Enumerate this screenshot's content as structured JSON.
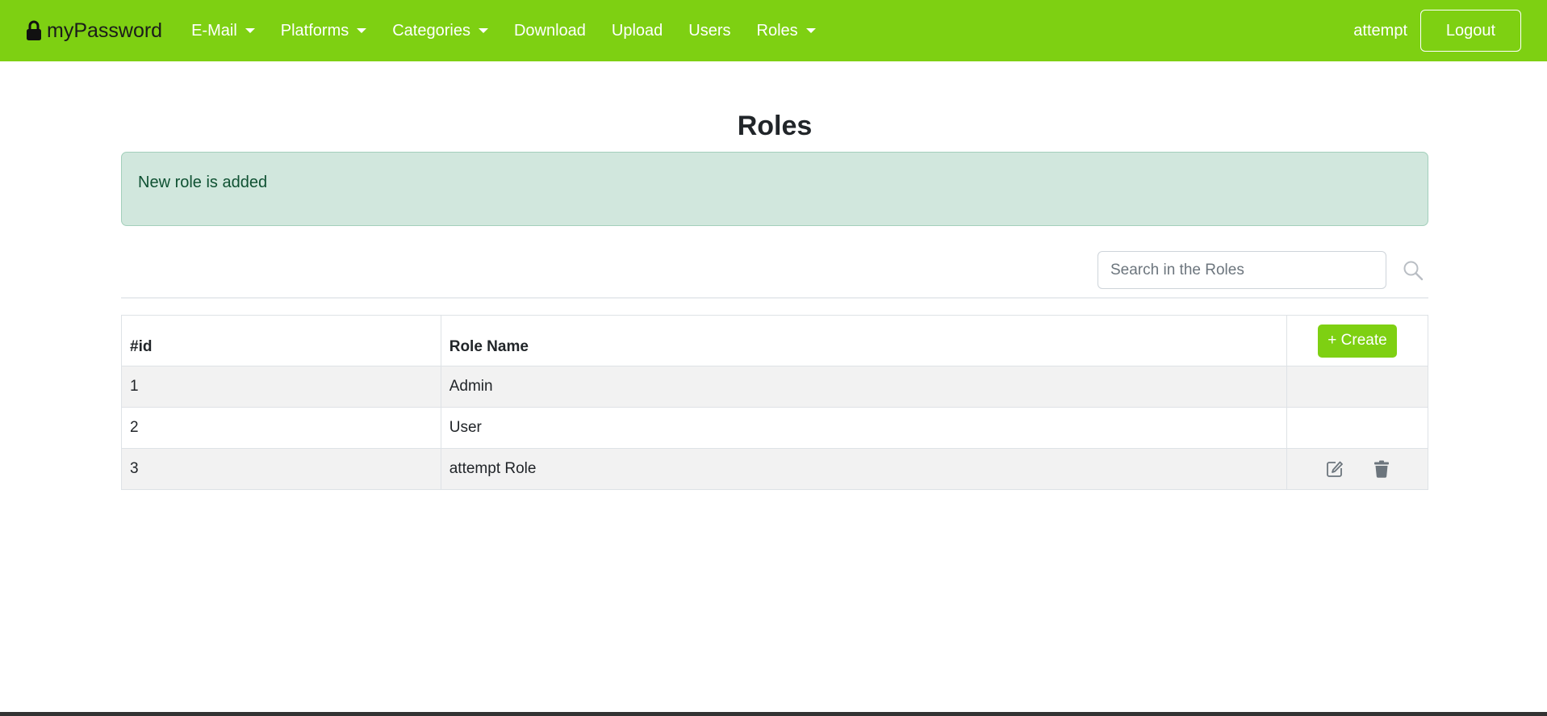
{
  "navbar": {
    "brand": "myPassword",
    "items": [
      {
        "label": "E-Mail",
        "dropdown": true
      },
      {
        "label": "Platforms",
        "dropdown": true
      },
      {
        "label": "Categories",
        "dropdown": true
      },
      {
        "label": "Download",
        "dropdown": false
      },
      {
        "label": "Upload",
        "dropdown": false
      },
      {
        "label": "Users",
        "dropdown": false
      },
      {
        "label": "Roles",
        "dropdown": true
      }
    ],
    "username": "attempt",
    "logout_label": "Logout"
  },
  "page": {
    "title": "Roles"
  },
  "alert": {
    "message": "New role is added"
  },
  "search": {
    "placeholder": "Search in the Roles",
    "value": ""
  },
  "table": {
    "headers": {
      "id": "#id",
      "name": "Role Name"
    },
    "create_label": "+ Create",
    "rows": [
      {
        "id": "1",
        "name": "Admin",
        "editable": false
      },
      {
        "id": "2",
        "name": "User",
        "editable": false
      },
      {
        "id": "3",
        "name": "attempt Role",
        "editable": true
      }
    ]
  },
  "icons": {
    "brand": "lock-icon",
    "search": "search-icon",
    "edit": "edit-icon",
    "delete": "trash-icon"
  },
  "colors": {
    "brand_green": "#7ed012",
    "alert_bg": "#d1e7dd",
    "alert_text": "#0f5132"
  }
}
